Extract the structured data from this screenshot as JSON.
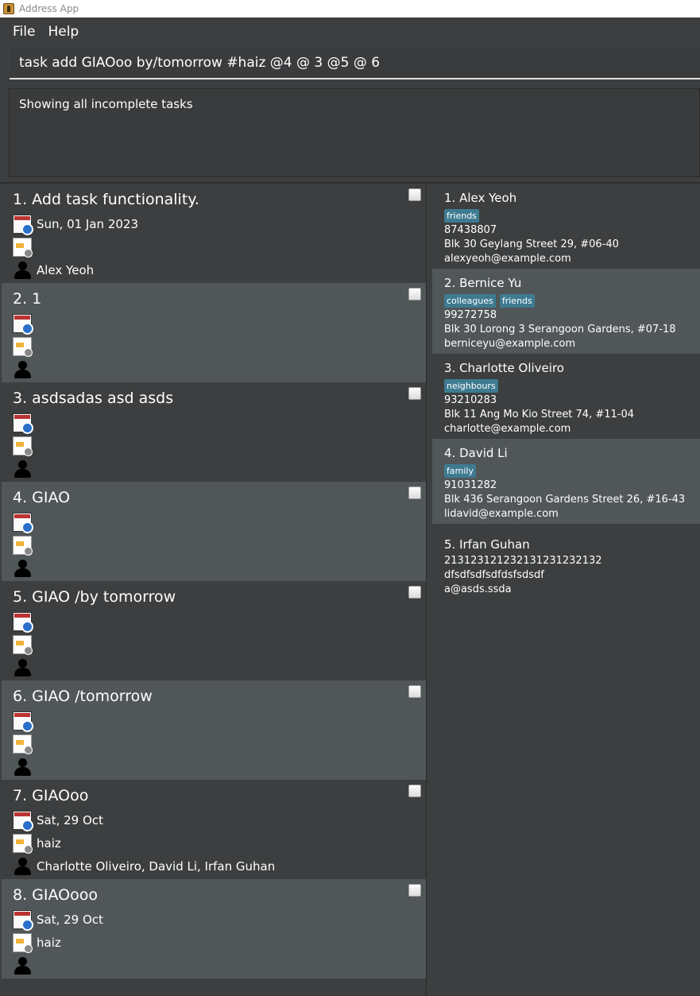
{
  "window": {
    "title": "Address App"
  },
  "menu": {
    "file": "File",
    "help": "Help"
  },
  "command": {
    "value": "task add GIAOoo by/tomorrow #haiz @4 @ 3 @5 @ 6"
  },
  "result": {
    "text": "Showing all incomplete tasks"
  },
  "tasks": [
    {
      "title": "1. Add task functionality.",
      "deadline": "Sun, 01 Jan 2023",
      "tag": "",
      "assignees": "Alex Yeoh",
      "done": false
    },
    {
      "title": "2. 1",
      "deadline": "",
      "tag": "",
      "assignees": "",
      "done": false
    },
    {
      "title": "3. asdsadas asd asds",
      "deadline": "",
      "tag": "",
      "assignees": "",
      "done": false
    },
    {
      "title": "4. GIAO",
      "deadline": "",
      "tag": "",
      "assignees": "",
      "done": false
    },
    {
      "title": "5. GIAO /by tomorrow",
      "deadline": "",
      "tag": "",
      "assignees": "",
      "done": false
    },
    {
      "title": "6. GIAO  /tomorrow",
      "deadline": "",
      "tag": "",
      "assignees": "",
      "done": false
    },
    {
      "title": "7. GIAOoo",
      "deadline": "Sat, 29 Oct",
      "tag": "haiz",
      "assignees": "Charlotte Oliveiro, David Li, Irfan Guhan",
      "done": false
    },
    {
      "title": "8. GIAOooo",
      "deadline": "Sat, 29 Oct",
      "tag": "haiz",
      "assignees": "",
      "done": false
    }
  ],
  "persons": [
    {
      "name": "1.  Alex Yeoh",
      "tags": [
        "friends"
      ],
      "phone": "87438807",
      "address": "Blk 30 Geylang Street 29, #06-40",
      "email": "alexyeoh@example.com"
    },
    {
      "name": "2.  Bernice Yu",
      "tags": [
        "colleagues",
        "friends"
      ],
      "phone": "99272758",
      "address": "Blk 30 Lorong 3 Serangoon Gardens, #07-18",
      "email": "berniceyu@example.com"
    },
    {
      "name": "3.  Charlotte Oliveiro",
      "tags": [
        "neighbours"
      ],
      "phone": "93210283",
      "address": "Blk 11 Ang Mo Kio Street 74, #11-04",
      "email": "charlotte@example.com"
    },
    {
      "name": "4.  David Li",
      "tags": [
        "family"
      ],
      "phone": "91031282",
      "address": "Blk 436 Serangoon Gardens Street 26, #16-43",
      "email": "lidavid@example.com"
    },
    {
      "name": "5.  Irfan Guhan",
      "tags": [],
      "phone": "213123121232131231232132",
      "address": "dfsdfsdfsdfdsfsdsdf",
      "email": "a@asds.ssda"
    }
  ],
  "colors": {
    "background": "#3c3e3f",
    "card_alt": "#515658",
    "tag": "#3e7b91"
  }
}
